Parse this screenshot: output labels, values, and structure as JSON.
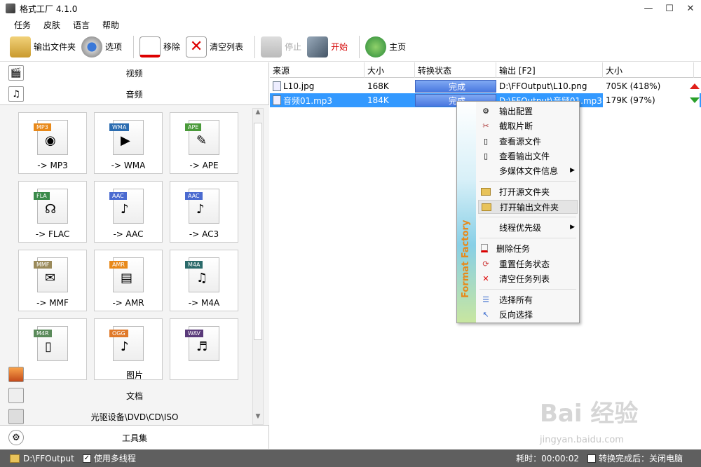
{
  "window": {
    "title": "格式工厂 4.1.0",
    "controls": [
      "—",
      "☐",
      "✕"
    ]
  },
  "menu": {
    "items": [
      "任务",
      "皮肤",
      "语言",
      "帮助"
    ]
  },
  "toolbar": {
    "output_folder": "输出文件夹",
    "options": "选项",
    "remove": "移除",
    "clear_list": "清空列表",
    "stop": "停止",
    "start": "开始",
    "home": "主页"
  },
  "left": {
    "categories_top": [
      {
        "label": "视频",
        "icon": "video-icon"
      },
      {
        "label": "音频",
        "icon": "audio-icon"
      }
    ],
    "tiles": [
      {
        "badge": "MP3",
        "label": "-> MP3",
        "color": "#e8891a",
        "glyph": "◉"
      },
      {
        "badge": "WMA",
        "label": "-> WMA",
        "color": "#2b6cb0",
        "glyph": "▶"
      },
      {
        "badge": "APE",
        "label": "-> APE",
        "color": "#4a9a3a",
        "glyph": "✎"
      },
      {
        "badge": "FLA",
        "label": "-> FLAC",
        "color": "#3a8a4a",
        "glyph": "☊"
      },
      {
        "badge": "AAC",
        "label": "-> AAC",
        "color": "#4a6ad0",
        "glyph": "♪"
      },
      {
        "badge": "AAC",
        "label": "-> AC3",
        "color": "#4a6ad0",
        "glyph": "♪"
      },
      {
        "badge": "MMF",
        "label": "-> MMF",
        "color": "#9a8a5a",
        "glyph": "✉"
      },
      {
        "badge": "AMR",
        "label": "-> AMR",
        "color": "#e8891a",
        "glyph": "▤"
      },
      {
        "badge": "M4A",
        "label": "-> M4A",
        "color": "#2a6a6a",
        "glyph": "♫"
      },
      {
        "badge": "M4R",
        "label": "",
        "color": "#5a8a5a",
        "glyph": "▯"
      },
      {
        "badge": "OGG",
        "label": "",
        "color": "#e07a2a",
        "glyph": "♪"
      },
      {
        "badge": "WAV",
        "label": "",
        "color": "#5a3a7a",
        "glyph": "♬"
      }
    ],
    "categories_bottom": [
      {
        "label": "图片",
        "icon": "image-icon"
      },
      {
        "label": "文档",
        "icon": "document-icon"
      },
      {
        "label": "光驱设备\\DVD\\CD\\ISO",
        "icon": "disc-drive-icon"
      },
      {
        "label": "工具集",
        "icon": "toolbox-icon"
      }
    ]
  },
  "table": {
    "headers": [
      "来源",
      "大小",
      "转换状态",
      "输出 [F2]",
      "大小"
    ],
    "rows": [
      {
        "source": "L10.jpg",
        "size": "168K",
        "status": "完成",
        "output": "D:\\FFOutput\\L10.png",
        "out_size": "705K  (418%)",
        "trend": "up"
      },
      {
        "source": "音频01.mp3",
        "size": "184K",
        "status": "完成",
        "output": "D:\\FFOutput\\音频01.mp3",
        "out_size": "179K  (97%)",
        "trend": "down"
      }
    ]
  },
  "context_menu": {
    "brand": "Format Factory",
    "items": [
      {
        "label": "输出配置",
        "icon": "gear-icon",
        "submenu": false
      },
      {
        "label": "截取片断",
        "icon": "clip-icon",
        "submenu": false
      },
      {
        "label": "查看源文件",
        "icon": "source-file-icon",
        "submenu": false
      },
      {
        "label": "查看输出文件",
        "icon": "output-file-icon",
        "submenu": false
      },
      {
        "label": "多媒体文件信息",
        "icon": "",
        "submenu": true
      },
      {
        "label": "打开源文件夹",
        "icon": "folder-icon",
        "submenu": false
      },
      {
        "label": "打开输出文件夹",
        "icon": "folder-open-icon",
        "submenu": false
      },
      {
        "label": "线程优先级",
        "icon": "",
        "submenu": true
      },
      {
        "label": "删除任务",
        "icon": "delete-task-icon",
        "submenu": false
      },
      {
        "label": "重置任务状态",
        "icon": "reset-icon",
        "submenu": false
      },
      {
        "label": "清空任务列表",
        "icon": "clear-list-icon",
        "submenu": false
      },
      {
        "label": "选择所有",
        "icon": "select-all-icon",
        "submenu": false
      },
      {
        "label": "反向选择",
        "icon": "invert-select-icon",
        "submenu": false
      }
    ]
  },
  "statusbar": {
    "output_path": "D:\\FFOutput",
    "multithread": "使用多线程",
    "elapsed": "耗时：00:00:02",
    "after_done": "转换完成后：关闭电脑"
  },
  "watermark": {
    "main": "Bai 经验",
    "sub": "jingyan.baidu.com"
  }
}
